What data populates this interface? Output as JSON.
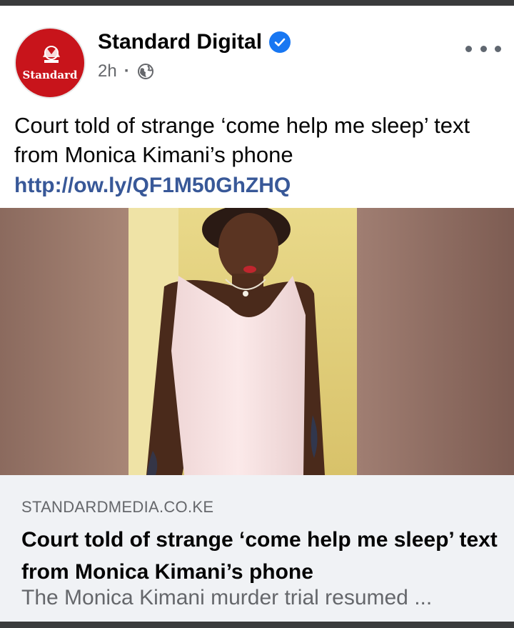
{
  "post": {
    "page_name": "Standard Digital",
    "time": "2h",
    "separator": "·",
    "privacy_icon": "globe-icon",
    "verified_icon": "verified-badge-icon",
    "avatar_text": "Standard",
    "text": "Court told of strange ‘come help me sleep’ text from Monica Kimani’s phone",
    "link": "http://ow.ly/QF1M50GhZHQ"
  },
  "link_card": {
    "domain": "STANDARDMEDIA.CO.KE",
    "title": "Court told of strange ‘come help me sleep’ text from Monica Kimani’s phone",
    "description": "The Monica Kimani murder trial resumed ..."
  },
  "colors": {
    "brand_red": "#c8141b",
    "verified_blue": "#1877f2",
    "link_blue": "#385898"
  }
}
